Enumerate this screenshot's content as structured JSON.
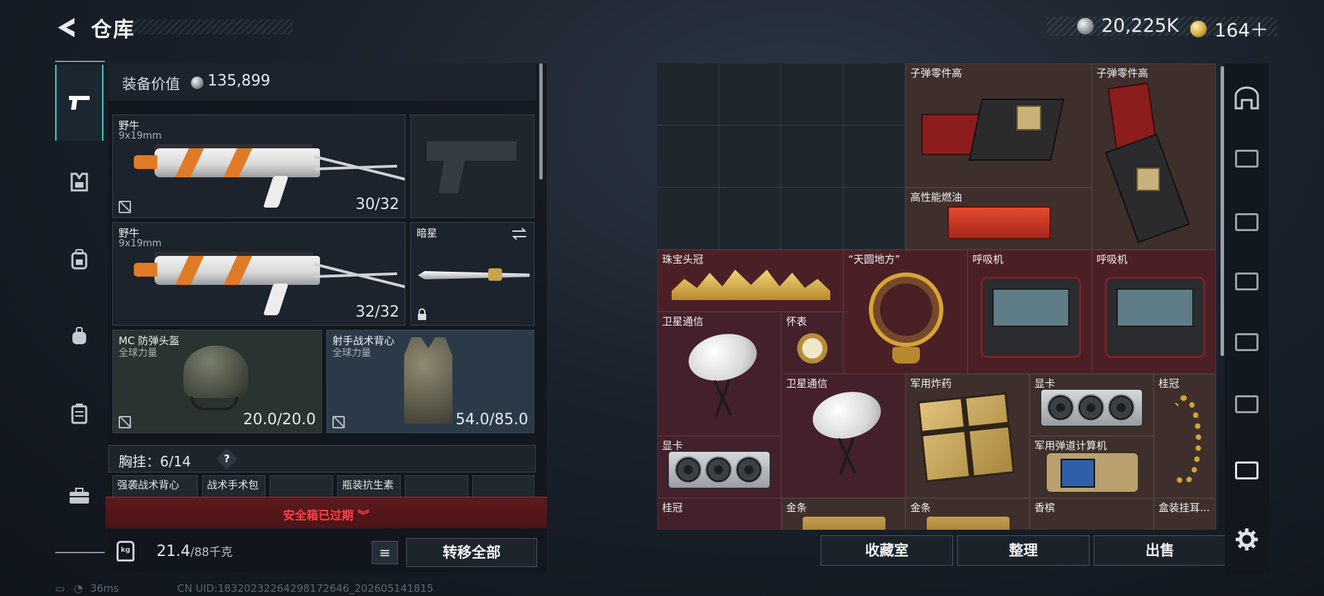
{
  "header": {
    "title": "仓库"
  },
  "currency": {
    "silver": "20,225K",
    "gold": "164＋"
  },
  "equipment": {
    "value_label": "装备价值",
    "value": "135,899",
    "slots": [
      {
        "name": "野牛",
        "sub": "9x19mm",
        "count": "30/32"
      },
      {
        "name": "野牛",
        "sub": "9x19mm",
        "count": "32/32"
      },
      {
        "name": "暗星"
      },
      {
        "name": "MC 防弹头盔",
        "sub": "全球力量",
        "count": "20.0/20.0"
      },
      {
        "name": "射手战术背心",
        "sub": "全球力量",
        "count": "54.0/85.0"
      }
    ],
    "chest_rig": {
      "label": "胸挂：6/14",
      "help": "?"
    },
    "mini_slots": [
      "强袭战术背心",
      "战术手术包",
      "",
      "瓶装抗生素",
      "",
      ""
    ],
    "safebox": "安全箱已过期",
    "weight": {
      "icon": "kg",
      "value": "21.4",
      "max": "/88千克"
    },
    "list_icon": "≡",
    "transfer_all": "转移全部"
  },
  "stash_items": [
    {
      "name": "子弹零件高"
    },
    {
      "name": "子弹零件高"
    },
    {
      "name": "高性能燃油"
    },
    {
      "name": "珠宝头冠"
    },
    {
      "name": "“天圆地方”"
    },
    {
      "name": "呼吸机"
    },
    {
      "name": "呼吸机"
    },
    {
      "name": "卫星通信"
    },
    {
      "name": "怀表"
    },
    {
      "name": "卫星通信"
    },
    {
      "name": "军用炸药"
    },
    {
      "name": "显卡"
    },
    {
      "name": "桂冠"
    },
    {
      "name": "显卡"
    },
    {
      "name": "军用弹道计算机"
    },
    {
      "name": "桂冠"
    },
    {
      "name": "金条"
    },
    {
      "name": "金条"
    },
    {
      "name": "香槟"
    },
    {
      "name": "盒装挂耳..."
    }
  ],
  "bottom_buttons": {
    "collection": "收藏室",
    "organize": "整理",
    "sell": "出售"
  },
  "footer": {
    "ping": "36ms",
    "uid": "CN UID:1832023226429817264​6_202605141815"
  },
  "colors": {
    "accent": "#3fd0c4",
    "danger": "#ff3f44",
    "brown_tile": "#3e2f2c",
    "red_tile": "#4a2026"
  }
}
